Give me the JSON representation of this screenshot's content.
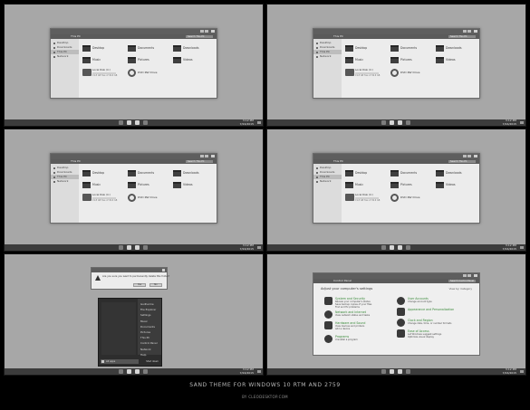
{
  "explorer": {
    "path": "This PC",
    "search_placeholder": "Search This PC",
    "sidebar": [
      "Desktop",
      "Downloads",
      "This PC",
      "Network"
    ],
    "folders": [
      "Desktop",
      "Documents",
      "Downloads",
      "Music",
      "Pictures",
      "Videos"
    ],
    "drive": {
      "name": "Local Disk (C:)",
      "free": "19.8 GB free of 49.6 GB",
      "used_fraction": 0.6
    },
    "dvd": "DVD RW Drive"
  },
  "taskbar": {
    "time": "3:12 PM",
    "date": "7/24/2015"
  },
  "dialog": {
    "text": "Are you sure you want to permanently delete this folder?",
    "yes": "Yes",
    "no": "No"
  },
  "start_menu": {
    "items": [
      "Guilherme",
      "File Explorer",
      "Settings",
      "Music",
      "Documents",
      "Pictures",
      "This PC",
      "Control Panel",
      "Network",
      "Help"
    ],
    "search": "All apps",
    "power": "Shut down"
  },
  "control_panel": {
    "path": "Control Panel",
    "search_placeholder": "Search Control Panel",
    "heading": "Adjust your computer's settings",
    "view_by": "View by: Category",
    "categories_left": [
      {
        "title": "System and Security",
        "subs": [
          "Review your computer's status",
          "Save backup copies of your files",
          "Find and fix problems"
        ]
      },
      {
        "title": "Network and Internet",
        "subs": [
          "View network status and tasks"
        ]
      },
      {
        "title": "Hardware and Sound",
        "subs": [
          "View devices and printers",
          "Add a device"
        ]
      },
      {
        "title": "Programs",
        "subs": [
          "Uninstall a program"
        ]
      }
    ],
    "categories_right": [
      {
        "title": "User Accounts",
        "subs": [
          "Change account type"
        ]
      },
      {
        "title": "Appearance and Personalization",
        "subs": []
      },
      {
        "title": "Clock and Region",
        "subs": [
          "Change date, time, or number formats"
        ]
      },
      {
        "title": "Ease of Access",
        "subs": [
          "Let Windows suggest settings",
          "Optimize visual display"
        ]
      }
    ]
  },
  "caption": {
    "title": "SAND THEME FOR WINDOWS 10 RTM AND 2759",
    "credit": "BY CLEODESKTOP.COM"
  }
}
